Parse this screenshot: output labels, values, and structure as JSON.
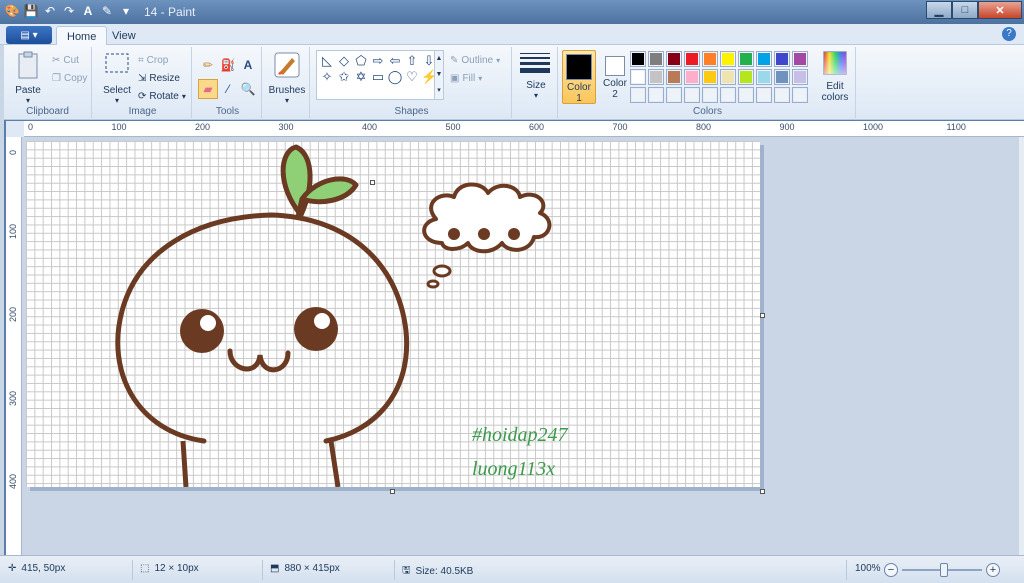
{
  "window": {
    "title": "14 - Paint",
    "minimize_icon": "minimize-icon",
    "maximize_icon": "maximize-icon",
    "close_icon": "close-icon"
  },
  "tabs": [
    {
      "label": "Home",
      "active": true
    },
    {
      "label": "View",
      "active": false
    }
  ],
  "ribbon": {
    "clipboard": {
      "label": "Clipboard",
      "paste": "Paste",
      "cut": "Cut",
      "copy": "Copy"
    },
    "image": {
      "label": "Image",
      "select": "Select",
      "crop": "Crop",
      "resize": "Resize",
      "rotate": "Rotate"
    },
    "tools": {
      "label": "Tools",
      "items": [
        "pencil-icon",
        "fill-icon",
        "text-icon",
        "eraser-icon",
        "color-picker-icon",
        "magnifier-icon"
      ],
      "selected": "eraser-icon"
    },
    "brushes": {
      "label": "Brushes"
    },
    "shapes": {
      "label": "Shapes",
      "outline": "Outline",
      "fill": "Fill",
      "items": [
        "◺",
        "◇",
        "⬠",
        "⇨",
        "⇦",
        "⇧",
        "⇩",
        "✧",
        "✩",
        "✡",
        "▭",
        "◯",
        "♡",
        "⚡"
      ]
    },
    "size": {
      "label": "Size"
    },
    "colors": {
      "label": "Colors",
      "color1_label": "Color\n1",
      "color1_line1": "Color",
      "color1_line2": "1",
      "color2_line1": "Color",
      "color2_line2": "2",
      "color1": "#000000",
      "color2": "#ffffff",
      "edit_label_1": "Edit",
      "edit_label_2": "colors",
      "palette_row1": [
        "#000000",
        "#7f7f7f",
        "#880015",
        "#ed1c24",
        "#ff7f27",
        "#fff200",
        "#22b14c",
        "#00a2e8",
        "#3f48cc",
        "#a349a4"
      ],
      "palette_row2": [
        "#ffffff",
        "#c3c3c3",
        "#b97a57",
        "#ffaec9",
        "#ffc90e",
        "#efe4b0",
        "#b5e61d",
        "#99d9ea",
        "#7092be",
        "#c8bfe7"
      ]
    }
  },
  "ruler": {
    "h": [
      "0",
      "100",
      "200",
      "300",
      "400",
      "500",
      "600",
      "700",
      "800",
      "900",
      "1000",
      "1100"
    ],
    "v": [
      "0",
      "100",
      "200",
      "300",
      "400"
    ]
  },
  "canvas_text": {
    "line1": "#hoidap247",
    "line2": "luong113x"
  },
  "status": {
    "cursor": "415, 50px",
    "selection": "12 × 10px",
    "image_size": "880 × 415px",
    "file_size": "Size: 40.5KB",
    "zoom": "100%"
  }
}
